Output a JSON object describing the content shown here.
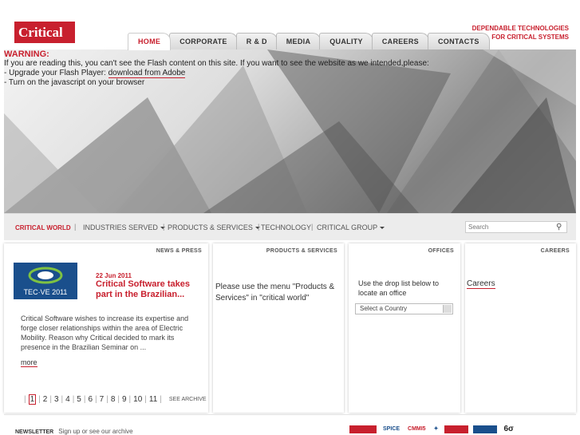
{
  "header": {
    "logo_text": "Critical",
    "tagline_line1": "DEPENDABLE TECHNOLOGIES",
    "tagline_line2": "FOR CRITICAL SYSTEMS",
    "nav": [
      "HOME",
      "CORPORATE",
      "R & D",
      "MEDIA",
      "QUALITY",
      "CAREERS",
      "CONTACTS"
    ]
  },
  "warning": {
    "title": "WARNING:",
    "line1": "If you are reading this, you can't see the Flash content on this site. If you want to see the website as we intended,please:",
    "line2_prefix": "- Upgrade your Flash Player: ",
    "line2_link": "download from Adobe",
    "line3": "- Turn on the javascript on your browser"
  },
  "submenu": {
    "critical_world": "CRITICAL WORLD",
    "industries": "INDUSTRIES SERVED",
    "products": "PRODUCTS & SERVICES",
    "technology": "TECHNOLOGY",
    "group": "CRITICAL GROUP",
    "search_placeholder": "Search"
  },
  "news": {
    "title": "NEWS & PRESS",
    "thumb_text": "TEC·VE 2011",
    "date": "22 Jun 2011",
    "headline": "Critical Software takes part in the Brazilian...",
    "body": "Critical Software wishes to increase its expertise and forge closer relationships within the area of Electric Mobility. Reason why Critical decided to mark its presence in the Brazilian Seminar on ...",
    "more": "more",
    "pages": [
      "1",
      "2",
      "3",
      "4",
      "5",
      "6",
      "7",
      "8",
      "9",
      "10",
      "11"
    ],
    "archive": "SEE ARCHIVE"
  },
  "products": {
    "title": "PRODUCTS & SERVICES",
    "text": "Please use the menu \"Products & Services\" in \"critical world\""
  },
  "offices": {
    "title": "OFFICES",
    "text": "Use the drop list below to locate an office",
    "select": "Select a Country"
  },
  "careers": {
    "title": "CAREERS",
    "link": "Careers"
  },
  "footer": {
    "newsletter_label": "NEWSLETTER",
    "newsletter_text": "Sign up or see our archive",
    "cert1": "SPICE",
    "cert2": "CMMI5",
    "cert3": "6σ"
  },
  "colors": {
    "brand_red": "#c8202e"
  }
}
